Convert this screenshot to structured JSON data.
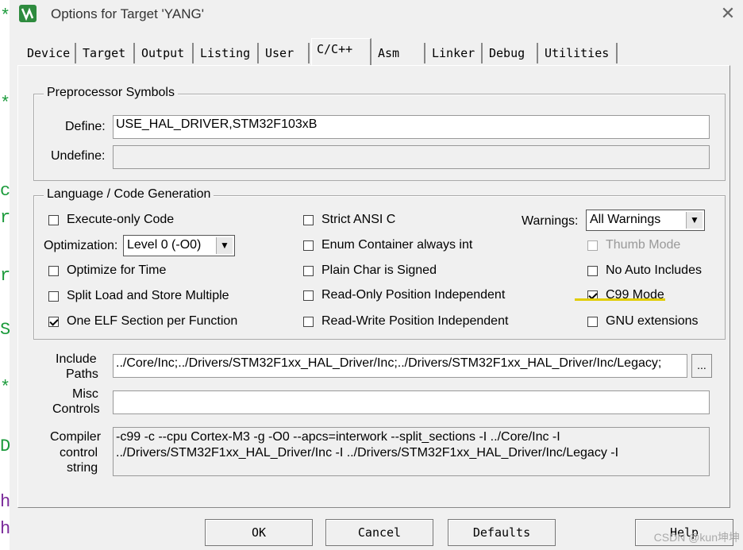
{
  "window": {
    "title": "Options for Target 'YANG'",
    "close_glyph": "✕",
    "icon": "keil-uvision-icon"
  },
  "side_text": [
    "*",
    "*",
    "c",
    "r",
    "r",
    "S",
    "*",
    "D",
    "h",
    "h"
  ],
  "tabs": [
    "Device",
    "Target",
    "Output",
    "Listing",
    "User",
    "C/C++",
    "Asm",
    "Linker",
    "Debug",
    "Utilities"
  ],
  "active_tab": "C/C++",
  "preprocessor": {
    "title": "Preprocessor Symbols",
    "define_label": "Define:",
    "define_value": "USE_HAL_DRIVER,STM32F103xB",
    "undefine_label": "Undefine:",
    "undefine_value": ""
  },
  "language": {
    "title": "Language / Code Generation",
    "execute_only": {
      "label": "Execute-only Code",
      "checked": false
    },
    "optimization_label": "Optimization:",
    "optimization_value": "Level 0 (-O0)",
    "optimize_time": {
      "label": "Optimize for Time",
      "checked": false
    },
    "split_load": {
      "label": "Split Load and Store Multiple",
      "checked": false
    },
    "one_elf": {
      "label": "One ELF Section per Function",
      "checked": true
    },
    "strict_ansi": {
      "label": "Strict ANSI C",
      "checked": false
    },
    "enum_container": {
      "label": "Enum Container always int",
      "checked": false
    },
    "plain_char": {
      "label": "Plain Char is Signed",
      "checked": false
    },
    "ro_pi": {
      "label": "Read-Only Position Independent",
      "checked": false
    },
    "rw_pi": {
      "label": "Read-Write Position Independent",
      "checked": false
    },
    "warnings_label": "Warnings:",
    "warnings_value": "All Warnings",
    "thumb_mode": {
      "label": "Thumb Mode",
      "checked": false
    },
    "no_auto_includes": {
      "label": "No Auto Includes",
      "checked": false
    },
    "c99_mode": {
      "label": "C99 Mode",
      "checked": true
    },
    "gnu_ext": {
      "label": "GNU extensions",
      "checked": false
    }
  },
  "include_paths": {
    "label_1": "Include",
    "label_2": "Paths",
    "value": "../Core/Inc;../Drivers/STM32F1xx_HAL_Driver/Inc;../Drivers/STM32F1xx_HAL_Driver/Inc/Legacy;",
    "browse": "..."
  },
  "misc_controls": {
    "label_1": "Misc",
    "label_2": "Controls",
    "value": ""
  },
  "compiler_control": {
    "label_1": "Compiler",
    "label_2": "control",
    "label_3": "string",
    "line_1": "-c99 -c --cpu Cortex-M3 -g -O0 --apcs=interwork --split_sections -I ../Core/Inc -I",
    "line_2": "../Drivers/STM32F1xx_HAL_Driver/Inc -I ../Drivers/STM32F1xx_HAL_Driver/Inc/Legacy -I"
  },
  "buttons": {
    "ok": "OK",
    "cancel": "Cancel",
    "defaults": "Defaults",
    "help": "Help"
  },
  "watermark": "CSDN @kun坤坤",
  "colors": {
    "highlight_underline": "#e0cc00",
    "side_text_green": "#1a9a3a",
    "side_text_purple": "#7a2a9a"
  }
}
